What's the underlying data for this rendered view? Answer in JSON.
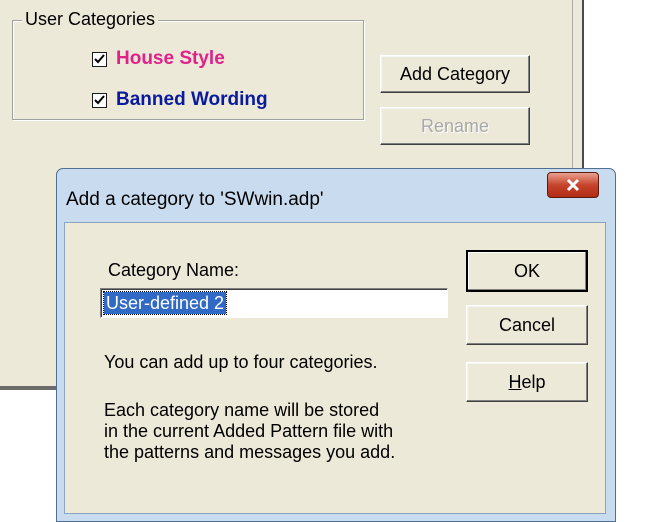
{
  "background_window": {
    "group_label": "User Categories",
    "categories": [
      {
        "label": "House Style",
        "checked": true,
        "color": "#e0218a"
      },
      {
        "label": "Banned Wording",
        "checked": true,
        "color": "#0a1a9e"
      }
    ],
    "add_category_label": "Add Category",
    "rename_label": "Rename"
  },
  "dialog": {
    "title": "Add a category to 'SWwin.adp'",
    "close_icon": "close-icon",
    "category_name_label": "Category Name:",
    "category_name_value": "User-defined 2",
    "ok_label": "OK",
    "cancel_label": "Cancel",
    "help_label": "Help",
    "help_accelerator": "H",
    "info_text": "You can add up to four categories.",
    "description_lines": [
      "Each category name will be stored",
      "in the current Added Pattern file with",
      "the patterns and messages you add."
    ]
  },
  "colors": {
    "house_style": "#e0218a",
    "banned_wording": "#0a1a9e",
    "dialog_frame": "#c9dbef",
    "close_button": "#c6432c"
  }
}
